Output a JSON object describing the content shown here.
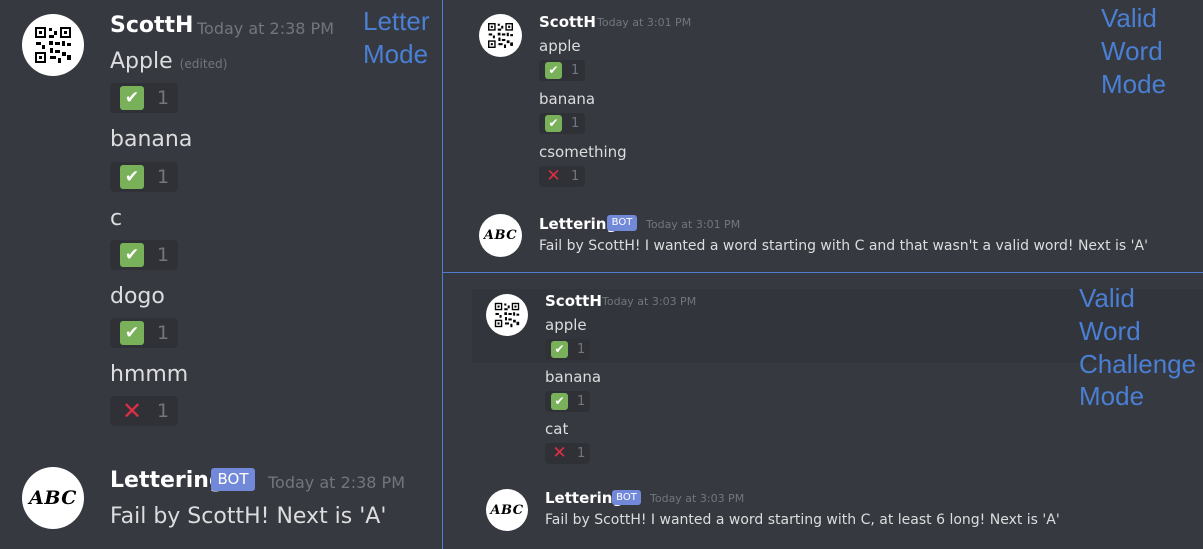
{
  "left": {
    "mode_label": [
      "Letter",
      "Mode"
    ],
    "scott_message": {
      "username": "ScottH",
      "timestamp": "Today at 2:38 PM",
      "items": [
        {
          "text": "Apple",
          "edited": "(edited)",
          "reaction": "check",
          "count": "1"
        },
        {
          "text": "banana",
          "reaction": "check",
          "count": "1"
        },
        {
          "text": "c",
          "reaction": "check",
          "count": "1"
        },
        {
          "text": "dogo",
          "reaction": "check",
          "count": "1"
        },
        {
          "text": "hmmm",
          "reaction": "cross",
          "count": "1"
        }
      ]
    },
    "bot_message": {
      "username": "Lettering",
      "badge": "BOT",
      "timestamp": "Today at 2:38 PM",
      "text": "Fail by ScottH! Next is 'A'"
    }
  },
  "top_right": {
    "mode_label": [
      "Valid",
      "Word",
      "Mode"
    ],
    "scott_message": {
      "username": "ScottH",
      "timestamp": "Today at 3:01 PM",
      "items": [
        {
          "text": "apple",
          "reaction": "check",
          "count": "1"
        },
        {
          "text": "banana",
          "reaction": "check",
          "count": "1"
        },
        {
          "text": "csomething",
          "reaction": "cross",
          "count": "1"
        }
      ]
    },
    "bot_message": {
      "username": "Lettering",
      "badge": "BOT",
      "timestamp": "Today at 3:01 PM",
      "text": "Fail by ScottH! I wanted a word starting with C and that wasn't a valid word! Next is 'A'"
    }
  },
  "bottom_right": {
    "mode_label": [
      "Valid",
      "Word",
      "Challenge",
      "Mode"
    ],
    "scott_message": {
      "username": "ScottH",
      "timestamp": "Today at 3:03 PM",
      "items": [
        {
          "text": "apple",
          "reaction": "check",
          "count": "1"
        },
        {
          "text": "banana",
          "reaction": "check",
          "count": "1"
        },
        {
          "text": "cat",
          "reaction": "cross",
          "count": "1"
        }
      ]
    },
    "bot_message": {
      "username": "Lettering",
      "badge": "BOT",
      "timestamp": "Today at 3:03 PM",
      "text": "Fail by ScottH! I wanted a word starting with C, at least 6 long! Next is 'A'"
    }
  },
  "icons": {
    "check": "✔",
    "cross": "✕",
    "avatar_bot_text": "ABC"
  },
  "colors": {
    "background": "#36393f",
    "check_green": "#78b159",
    "cross_red": "#dd2e44",
    "bot_badge": "#7289da",
    "annotation_blue": "#4a7fd4"
  }
}
